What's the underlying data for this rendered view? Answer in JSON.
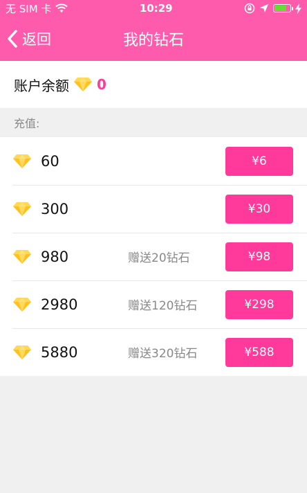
{
  "status_bar": {
    "carrier": "无 SIM 卡",
    "time": "10:29"
  },
  "nav": {
    "back_label": "返回",
    "title": "我的钻石"
  },
  "balance": {
    "label": "账户余额",
    "value": "0"
  },
  "recharge": {
    "header": "充值:",
    "items": [
      {
        "amount": "60",
        "bonus": "",
        "price": "¥6"
      },
      {
        "amount": "300",
        "bonus": "",
        "price": "¥30"
      },
      {
        "amount": "980",
        "bonus": "赠送20钻石",
        "price": "¥98"
      },
      {
        "amount": "2980",
        "bonus": "赠送120钻石",
        "price": "¥298"
      },
      {
        "amount": "5880",
        "bonus": "赠送320钻石",
        "price": "¥588"
      }
    ]
  },
  "colors": {
    "brand_pink": "#ff5bac",
    "button_pink": "#ff3a9a",
    "diamond_gold": "#ffc21a"
  },
  "icons": {
    "diamond": "diamond-icon",
    "back": "chevron-left-icon",
    "wifi": "wifi-icon",
    "location": "location-arrow-icon",
    "lock_rotation": "rotation-lock-icon",
    "battery": "battery-icon",
    "charging": "charging-bolt-icon"
  }
}
